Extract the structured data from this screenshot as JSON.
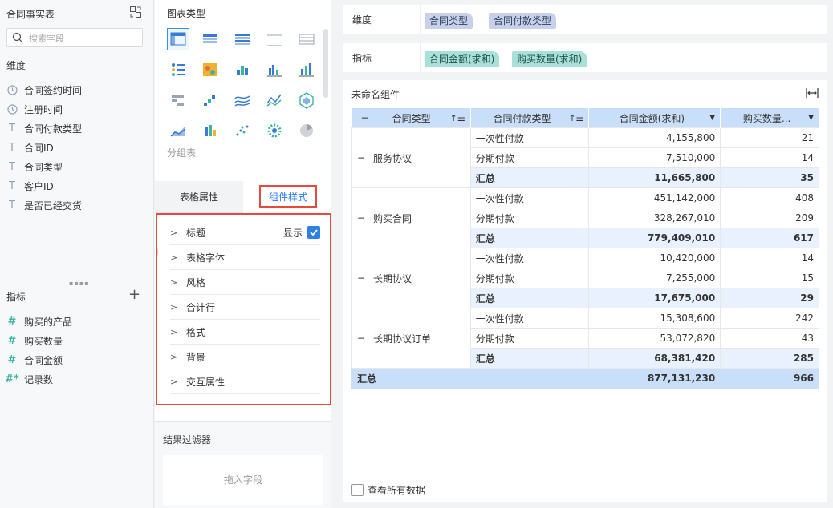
{
  "left": {
    "title": "合同事实表",
    "search_placeholder": "搜索字段",
    "dimensions_label": "维度",
    "dimensions": [
      {
        "icon": "clock-icon",
        "label": "合同签约时间"
      },
      {
        "icon": "clock-icon",
        "label": "注册时间"
      },
      {
        "icon": "text-icon",
        "label": "合同付款类型"
      },
      {
        "icon": "text-icon",
        "label": "合同ID"
      },
      {
        "icon": "text-icon",
        "label": "合同类型"
      },
      {
        "icon": "text-icon",
        "label": "客户ID"
      },
      {
        "icon": "text-icon",
        "label": "是否已经交货"
      }
    ],
    "measures_label": "指标",
    "measures": [
      {
        "icon": "hash-icon",
        "label": "购买的产品"
      },
      {
        "icon": "hash-icon",
        "label": "购买数量"
      },
      {
        "icon": "hash-icon",
        "label": "合同金额"
      },
      {
        "icon": "hash-star-icon",
        "label": "记录数"
      }
    ]
  },
  "middle": {
    "chart_type_label": "图表类型",
    "group_table_label": "分组表",
    "tab_table_props": "表格属性",
    "tab_component_style": "组件样式",
    "style_items": [
      "标题",
      "表格字体",
      "风格",
      "合计行",
      "格式",
      "背景",
      "交互属性"
    ],
    "title_show_label": "显示",
    "result_filter_label": "结果过滤器",
    "drop_field_hint": "拖入字段"
  },
  "right": {
    "dimension_label": "维度",
    "dimension_pills": [
      "合同类型",
      "合同付款类型"
    ],
    "indicator_label": "指标",
    "indicator_pills": [
      "合同金额(求和)",
      "购买数量(求和)"
    ],
    "component_title": "未命名组件",
    "columns": [
      "合同类型",
      "合同付款类型",
      "合同金额(求和)",
      "购买数量..."
    ],
    "groups": [
      {
        "name": "服务协议",
        "rows": [
          [
            "一次性付款",
            "4,155,800",
            "21"
          ],
          [
            "分期付款",
            "7,510,000",
            "14"
          ]
        ],
        "subtotal": [
          "汇总",
          "11,665,800",
          "35"
        ]
      },
      {
        "name": "购买合同",
        "rows": [
          [
            "一次性付款",
            "451,142,000",
            "408"
          ],
          [
            "分期付款",
            "328,267,010",
            "209"
          ]
        ],
        "subtotal": [
          "汇总",
          "779,409,010",
          "617"
        ]
      },
      {
        "name": "长期协议",
        "rows": [
          [
            "一次性付款",
            "10,420,000",
            "14"
          ],
          [
            "分期付款",
            "7,255,000",
            "15"
          ]
        ],
        "subtotal": [
          "汇总",
          "17,675,000",
          "29"
        ]
      },
      {
        "name": "长期协议订单",
        "rows": [
          [
            "一次性付款",
            "15,308,600",
            "242"
          ],
          [
            "分期付款",
            "53,072,820",
            "43"
          ]
        ],
        "subtotal": [
          "汇总",
          "68,381,420",
          "285"
        ]
      }
    ],
    "grand_total": [
      "汇总",
      "877,131,230",
      "966"
    ],
    "view_all_label": "查看所有数据"
  },
  "colors": {
    "accent": "#2878ff",
    "highlight_border": "#e24c3f",
    "dimension_pill": "#c7d2ea",
    "indicator_pill": "#a9e1d9",
    "table_header": "#c9def8"
  }
}
